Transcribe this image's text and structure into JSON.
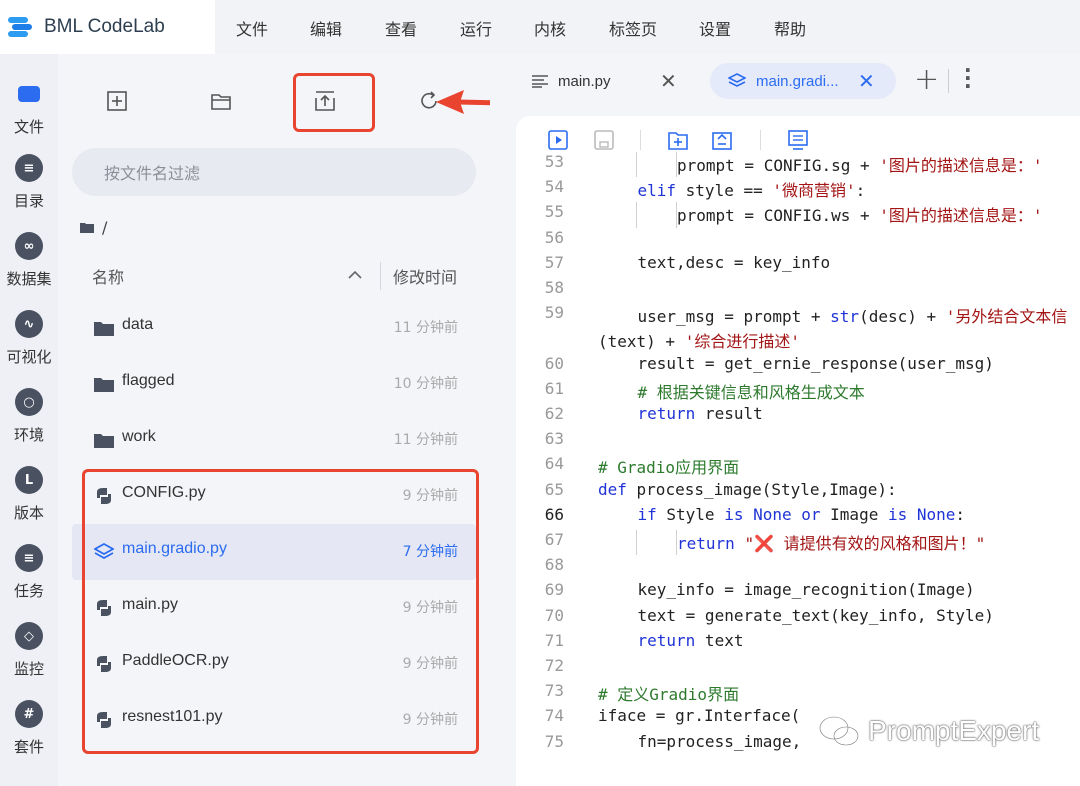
{
  "app": {
    "name": "BML CodeLab"
  },
  "menu": [
    "文件",
    "编辑",
    "查看",
    "运行",
    "内核",
    "标签页",
    "设置",
    "帮助"
  ],
  "activity": [
    "文件",
    "目录",
    "数据集",
    "可视化",
    "环境",
    "版本",
    "任务",
    "监控",
    "套件"
  ],
  "filepanel": {
    "filter_placeholder": "按文件名过滤",
    "path": "/",
    "col_name": "名称",
    "col_time": "修改时间",
    "rows": [
      {
        "name": "data",
        "time": "11 分钟前",
        "type": "folder"
      },
      {
        "name": "flagged",
        "time": "10 分钟前",
        "type": "folder"
      },
      {
        "name": "work",
        "time": "11 分钟前",
        "type": "folder"
      },
      {
        "name": "CONFIG.py",
        "time": "9 分钟前",
        "type": "python"
      },
      {
        "name": "main.gradio.py",
        "time": "7 分钟前",
        "type": "gradio",
        "selected": true
      },
      {
        "name": "main.py",
        "time": "9 分钟前",
        "type": "python"
      },
      {
        "name": "PaddleOCR.py",
        "time": "9 分钟前",
        "type": "python"
      },
      {
        "name": "resnest101.py",
        "time": "9 分钟前",
        "type": "python"
      }
    ]
  },
  "tabs": [
    {
      "label": "main.py",
      "active": false
    },
    {
      "label": "main.gradi...",
      "active": true
    }
  ],
  "code": {
    "current_line": 66,
    "lines": [
      {
        "n": "53",
        "i": 2,
        "t": [
          [
            "",
            "prompt = CONFIG.sg + "
          ],
          [
            "str",
            "'图片的描述信息是：'"
          ]
        ]
      },
      {
        "n": "54",
        "i": 1,
        "t": [
          [
            "kw",
            "elif"
          ],
          [
            "",
            " style == "
          ],
          [
            "str",
            "'微商营销'"
          ],
          [
            "",
            ":"
          ]
        ]
      },
      {
        "n": "55",
        "i": 2,
        "t": [
          [
            "",
            "prompt = CONFIG.ws + "
          ],
          [
            "str",
            "'图片的描述信息是：'"
          ]
        ]
      },
      {
        "n": "56",
        "i": 0,
        "t": []
      },
      {
        "n": "57",
        "i": 1,
        "t": [
          [
            "",
            "text,desc = key_info"
          ]
        ]
      },
      {
        "n": "58",
        "i": 0,
        "t": []
      },
      {
        "n": "59",
        "i": 1,
        "t": [
          [
            "",
            "user_msg = prompt + "
          ],
          [
            "kw",
            "str"
          ],
          [
            "",
            "(desc) + "
          ],
          [
            "str",
            "'另外结合文本信"
          ]
        ]
      },
      {
        "n": "",
        "i": -1,
        "t": [
          [
            "",
            "(text) + "
          ],
          [
            "str",
            "'综合进行描述'"
          ]
        ]
      },
      {
        "n": "60",
        "i": 1,
        "t": [
          [
            "",
            "result = get_ernie_response(user_msg)"
          ]
        ]
      },
      {
        "n": "61",
        "i": 1,
        "t": [
          [
            "cm",
            "# 根据关键信息和风格生成文本"
          ]
        ]
      },
      {
        "n": "62",
        "i": 1,
        "t": [
          [
            "kw",
            "return"
          ],
          [
            "",
            " result"
          ]
        ]
      },
      {
        "n": "63",
        "i": 0,
        "t": []
      },
      {
        "n": "64",
        "i": 0,
        "t": [
          [
            "cm",
            "# Gradio应用界面"
          ]
        ]
      },
      {
        "n": "65",
        "i": 0,
        "t": [
          [
            "kw",
            "def"
          ],
          [
            "",
            " process_image(Style,Image):"
          ]
        ]
      },
      {
        "n": "66",
        "i": 1,
        "t": [
          [
            "kw",
            "if"
          ],
          [
            "",
            " Style "
          ],
          [
            "kw",
            "is None or"
          ],
          [
            "",
            " Image "
          ],
          [
            "kw",
            "is None"
          ],
          [
            "",
            ":"
          ]
        ]
      },
      {
        "n": "67",
        "i": 2,
        "t": [
          [
            "kw",
            "return"
          ],
          [
            "",
            " "
          ],
          [
            "str",
            "\"❌ 请提供有效的风格和图片！\""
          ]
        ]
      },
      {
        "n": "68",
        "i": 0,
        "t": []
      },
      {
        "n": "69",
        "i": 1,
        "t": [
          [
            "",
            "key_info = image_recognition(Image)"
          ]
        ]
      },
      {
        "n": "70",
        "i": 1,
        "t": [
          [
            "",
            "text = generate_text(key_info, Style)"
          ]
        ]
      },
      {
        "n": "71",
        "i": 1,
        "t": [
          [
            "kw",
            "return"
          ],
          [
            "",
            " text"
          ]
        ]
      },
      {
        "n": "72",
        "i": 0,
        "t": []
      },
      {
        "n": "73",
        "i": 0,
        "t": [
          [
            "cm",
            "# 定义Gradio界面"
          ]
        ]
      },
      {
        "n": "74",
        "i": 0,
        "t": [
          [
            "",
            "iface = gr.Interface("
          ]
        ]
      },
      {
        "n": "75",
        "i": 1,
        "t": [
          [
            "",
            "fn=process_image,"
          ]
        ]
      }
    ]
  },
  "watermark": "PromptExpert",
  "colors": {
    "accent": "#2b6cf0",
    "highlight": "#e8442f"
  }
}
